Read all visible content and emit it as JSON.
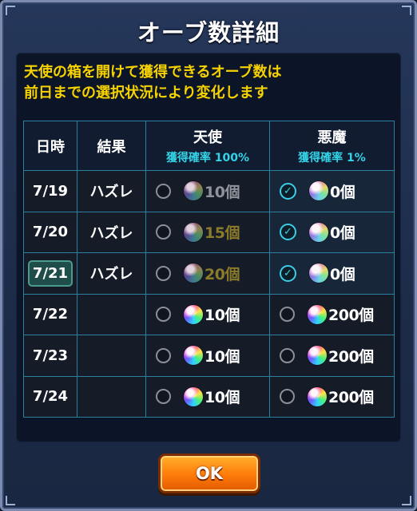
{
  "dialog": {
    "title": "オーブ数詳細",
    "description_line1": "天使の箱を開けて獲得できるオーブ数は",
    "description_line2": "前日までの選択状況により変化します"
  },
  "table": {
    "headers": {
      "date": "日時",
      "result": "結果",
      "angel": "天使",
      "angel_rate": "獲得確率 100%",
      "devil": "悪魔",
      "devil_rate": "獲得確率 1%"
    },
    "rows": [
      {
        "date": "7/19",
        "result": "ハズレ",
        "angel_amount": "10個",
        "devil_amount": "0個",
        "selected": "devil"
      },
      {
        "date": "7/20",
        "result": "ハズレ",
        "angel_amount": "15個",
        "devil_amount": "0個",
        "selected": "devil"
      },
      {
        "date": "7/21",
        "result": "ハズレ",
        "angel_amount": "20個",
        "devil_amount": "0個",
        "selected": "devil",
        "highlighted": true
      },
      {
        "date": "7/22",
        "result": "",
        "angel_amount": "10個",
        "devil_amount": "200個",
        "selected": "none"
      },
      {
        "date": "7/23",
        "result": "",
        "angel_amount": "10個",
        "devil_amount": "200個",
        "selected": "none"
      },
      {
        "date": "7/24",
        "result": "",
        "angel_amount": "10個",
        "devil_amount": "200個",
        "selected": "none"
      }
    ]
  },
  "buttons": {
    "ok_label": "OK"
  },
  "colors": {
    "accent_yellow": "#f6d200",
    "accent_cyan": "#34d4e8",
    "button_orange": "#ff7a0a"
  }
}
